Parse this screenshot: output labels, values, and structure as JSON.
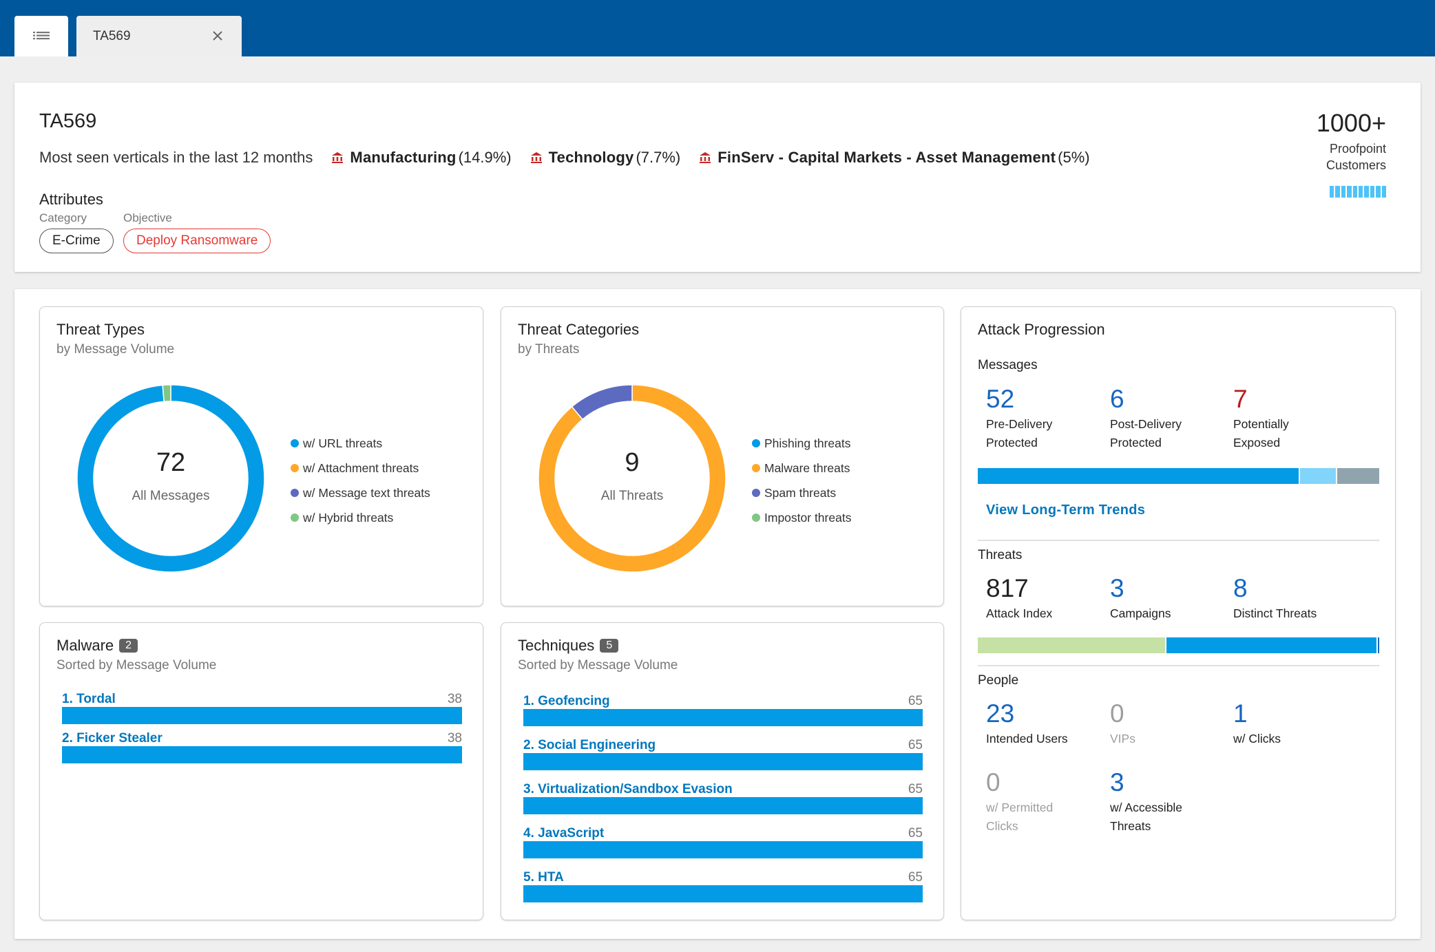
{
  "tabs": {
    "menu_icon": "list-icon",
    "active_tab": {
      "label": "TA569",
      "close_icon": "close-icon"
    }
  },
  "header": {
    "title": "TA569",
    "verticals_label": "Most seen verticals in the last 12 months",
    "verticals": [
      {
        "icon": "bank-icon",
        "name": "Manufacturing",
        "pct": "(14.9%)"
      },
      {
        "icon": "bank-icon",
        "name": "Technology",
        "pct": "(7.7%)"
      },
      {
        "icon": "bank-icon",
        "name": "FinServ - Capital Markets - Asset Management",
        "pct": "(5%)"
      }
    ],
    "attributes_title": "Attributes",
    "category_label": "Category",
    "category_value": "E-Crime",
    "objective_label": "Objective",
    "objective_value": "Deploy Ransomware",
    "customers_count": "1000+",
    "customers_label_1": "Proofpoint",
    "customers_label_2": "Customers",
    "customers_meter": {
      "filled": 10,
      "total": 10
    }
  },
  "threat_types": {
    "title": "Threat Types",
    "subtitle": "by Message Volume",
    "center_value": "72",
    "center_label": "All Messages"
  },
  "threat_categories": {
    "title": "Threat Categories",
    "subtitle": "by Threats",
    "center_value": "9",
    "center_label": "All Threats"
  },
  "chart_data": [
    {
      "type": "pie",
      "title": "Threat Types",
      "subtitle": "by Message Volume",
      "donut": true,
      "total": 72,
      "legend_position": "right",
      "series": [
        {
          "name": "w/ URL threats",
          "value": 71,
          "color": "#039be5"
        },
        {
          "name": "w/ Attachment threats",
          "value": 0,
          "color": "#ffa726"
        },
        {
          "name": "w/ Message text threats",
          "value": 0,
          "color": "#5c6bc0"
        },
        {
          "name": "w/ Hybrid threats",
          "value": 1,
          "color": "#81c784"
        }
      ]
    },
    {
      "type": "pie",
      "title": "Threat Categories",
      "subtitle": "by Threats",
      "donut": true,
      "total": 9,
      "legend_position": "right",
      "series": [
        {
          "name": "Phishing threats",
          "value": 0,
          "color": "#039be5"
        },
        {
          "name": "Malware threats",
          "value": 8,
          "color": "#ffa726"
        },
        {
          "name": "Spam threats",
          "value": 1,
          "color": "#5c6bc0"
        },
        {
          "name": "Impostor threats",
          "value": 0,
          "color": "#81c784"
        }
      ]
    },
    {
      "type": "bar",
      "title": "Malware",
      "subtitle": "Sorted by Message Volume",
      "categories": [
        "1. Tordal",
        "2. Ficker Stealer"
      ],
      "values": [
        38,
        38
      ]
    },
    {
      "type": "bar",
      "title": "Techniques",
      "subtitle": "Sorted by Message Volume",
      "categories": [
        "1. Geofencing",
        "2. Social Engineering",
        "3. Virtualization/Sandbox Evasion",
        "4. JavaScript",
        "5. HTA"
      ],
      "values": [
        65,
        65,
        65,
        65,
        65
      ]
    }
  ],
  "malware": {
    "title": "Malware",
    "count": "2",
    "subtitle": "Sorted by Message Volume",
    "items": [
      {
        "name": "1. Tordal",
        "value": "38",
        "fraction": 1.0
      },
      {
        "name": "2. Ficker Stealer",
        "value": "38",
        "fraction": 1.0
      }
    ]
  },
  "techniques": {
    "title": "Techniques",
    "count": "5",
    "subtitle": "Sorted by Message Volume",
    "items": [
      {
        "name": "1. Geofencing",
        "value": "65",
        "fraction": 1.0
      },
      {
        "name": "2. Social Engineering",
        "value": "65",
        "fraction": 1.0
      },
      {
        "name": "3. Virtualization/Sandbox Evasion",
        "value": "65",
        "fraction": 1.0
      },
      {
        "name": "4. JavaScript",
        "value": "65",
        "fraction": 1.0
      },
      {
        "name": "5. HTA",
        "value": "65",
        "fraction": 1.0
      }
    ]
  },
  "attack_progression": {
    "title": "Attack Progression",
    "messages": {
      "label": "Messages",
      "stats": [
        {
          "value": "52",
          "label_1": "Pre-Delivery",
          "label_2": "Protected"
        },
        {
          "value": "6",
          "label_1": "Post-Delivery",
          "label_2": "Protected"
        },
        {
          "value": "7",
          "label_1": "Potentially",
          "label_2": "Exposed"
        }
      ],
      "bar": [
        {
          "value": 52,
          "color": "#039be5"
        },
        {
          "value": 6,
          "color": "#81d4fa"
        },
        {
          "value": 7,
          "color": "#90a4ae"
        }
      ],
      "link": "View Long-Term Trends"
    },
    "threats": {
      "label": "Threats",
      "stats": [
        {
          "value": "817",
          "label": "Attack Index"
        },
        {
          "value": "3",
          "label": "Campaigns"
        },
        {
          "value": "8",
          "label": "Distinct Threats"
        }
      ],
      "bar": [
        {
          "fraction": 0.466,
          "color": "#c5e1a5"
        },
        {
          "fraction": 0.528,
          "color": "#039be5"
        },
        {
          "fraction": 0.006,
          "color": "#1565c0"
        }
      ]
    },
    "people": {
      "label": "People",
      "stats": [
        {
          "value": "23",
          "label_1": "Intended Users",
          "label_2": ""
        },
        {
          "value": "0",
          "label_1": "VIPs",
          "label_2": ""
        },
        {
          "value": "1",
          "label_1": "w/ Clicks",
          "label_2": ""
        },
        {
          "value": "0",
          "label_1": "w/ Permitted",
          "label_2": "Clicks"
        },
        {
          "value": "3",
          "label_1": "w/ Accessible",
          "label_2": "Threats"
        }
      ]
    }
  }
}
